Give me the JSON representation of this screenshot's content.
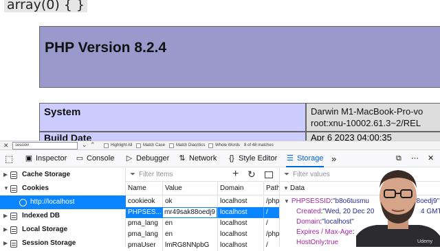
{
  "page": {
    "var_dump": "array(0) { }",
    "php_title": "PHP Version 8.2.4",
    "system_label": "System",
    "system_value_line1": "Darwin M1-MacBook-Pro-vo",
    "system_value_line2": "root:xnu-10002.61.3~2/REL",
    "build_date_label": "Build Date",
    "build_date_value": "Apr 6 2023 04:00:35"
  },
  "findbar": {
    "query": "session",
    "highlight_all": "Highlight All",
    "match_case": "Match Case",
    "match_diacritics": "Match Diacritics",
    "whole_words": "Whole Words",
    "match_count": "8 of 48 matches"
  },
  "toolbar": {
    "inspector": "Inspector",
    "console": "Console",
    "debugger": "Debugger",
    "network": "Network",
    "style_editor": "Style Editor",
    "storage": "Storage"
  },
  "storage_tree": {
    "cache_storage": "Cache Storage",
    "cookies": "Cookies",
    "localhost": "http://localhost",
    "indexed_db": "Indexed DB",
    "local_storage": "Local Storage",
    "session_storage": "Session Storage"
  },
  "cookie_table": {
    "filter_placeholder": "Filter Items",
    "columns": [
      "Name",
      "Value",
      "Domain",
      "Path"
    ],
    "rows": [
      {
        "name": "cookieok",
        "value": "ok",
        "domain": "localhost",
        "path": "/php"
      },
      {
        "name": "PHPSES...",
        "value": "mr49sak88oedj9",
        "domain": "localhost",
        "path": "/"
      },
      {
        "name": "pma_lang",
        "value": "en",
        "domain": "localhost",
        "path": "/"
      },
      {
        "name": "pma_lang",
        "value": "en",
        "domain": "localhost",
        "path": "/php"
      },
      {
        "name": "pmaUser",
        "value": "lmRG8NNpbG",
        "domain": "localhost",
        "path": "/"
      }
    ]
  },
  "details": {
    "filter_placeholder": "Filter values",
    "section": "Data",
    "cookie_name": "PHPSESSID",
    "cookie_value": "\"b8o6tusmu",
    "cookie_value_tail": "88oedj9\"",
    "created_key": "Created",
    "created_value": "\"Wed, 20 Dec 20",
    "created_value_tail": "4 GMT\"",
    "domain_key": "Domain",
    "domain_value": "\"localhost\"",
    "expires_key": "Expires / Max-Age",
    "hostonly_key": "HostOnly",
    "hostonly_value": "true"
  },
  "watermark": "Udemy"
}
